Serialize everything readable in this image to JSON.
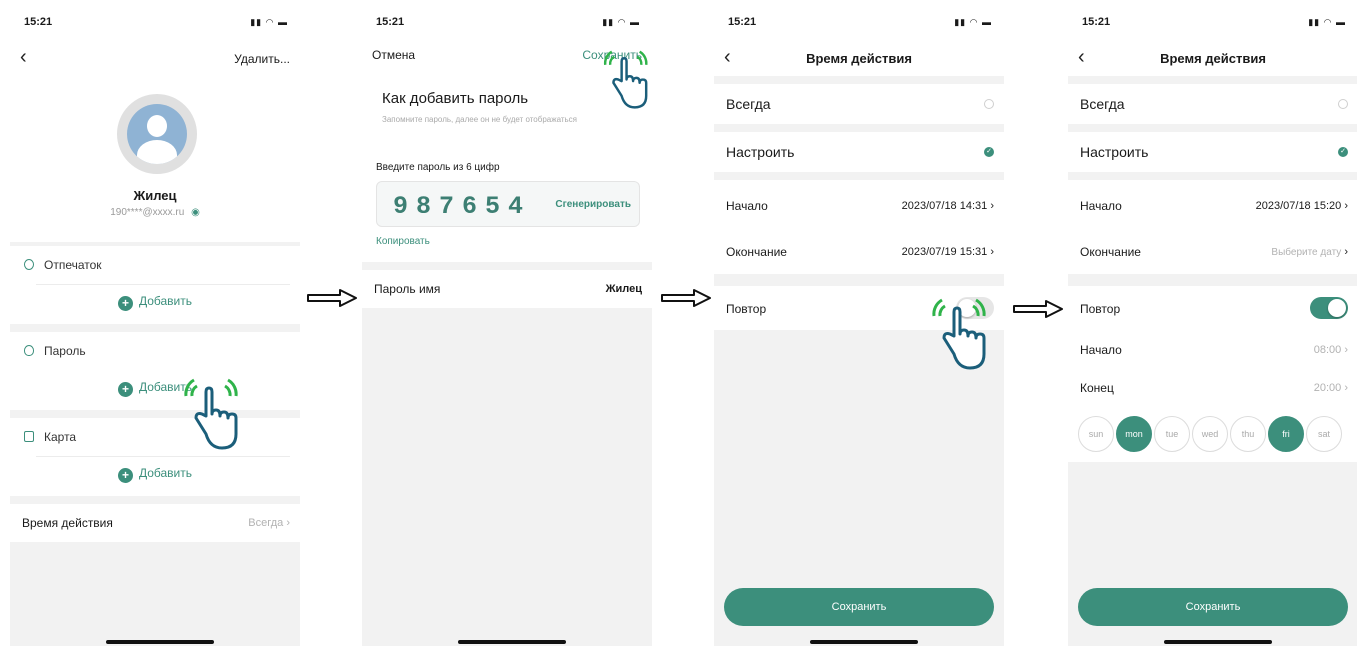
{
  "status": {
    "time": "15:21",
    "icons": "▮▮ ◠ ▬"
  },
  "screen1": {
    "right_action": "Удалить...",
    "user_name": "Жилец",
    "user_email": "190****@xxxx.ru",
    "sections": [
      {
        "label": "Отпечаток",
        "add": "Добавить"
      },
      {
        "label": "Пароль",
        "add": "Добавить"
      },
      {
        "label": "Карта",
        "add": "Добавить"
      }
    ],
    "validity_label": "Время действия",
    "validity_value": "Всегда"
  },
  "screen2": {
    "cancel": "Отмена",
    "save": "Сохранить",
    "heading": "Как добавить пароль",
    "hint": "Запомните пароль, далее он не будет отображаться",
    "pin_label": "Введите пароль из 6 цифр",
    "pin": "987654",
    "generate": "Сгенерировать",
    "copy": "Копировать",
    "name_label": "Пароль имя",
    "name_value": "Жилец"
  },
  "screen3": {
    "title": "Время действия",
    "always": "Всегда",
    "custom": "Настроить",
    "start_label": "Начало",
    "start_value": "2023/07/18 14:31",
    "end_label": "Окончание",
    "end_value": "2023/07/19 15:31",
    "repeat": "Повтор",
    "repeat_on": false,
    "save": "Сохранить"
  },
  "screen4": {
    "title": "Время действия",
    "always": "Всегда",
    "custom": "Настроить",
    "start_label": "Начало",
    "start_value": "2023/07/18 15:20",
    "end_label": "Окончание",
    "end_placeholder": "Выберите дату",
    "repeat": "Повтор",
    "repeat_on": true,
    "time_start_label": "Начало",
    "time_start_value": "08:00",
    "time_end_label": "Конец",
    "time_end_value": "20:00",
    "days": [
      {
        "label": "sun",
        "on": false
      },
      {
        "label": "mon",
        "on": true
      },
      {
        "label": "tue",
        "on": false
      },
      {
        "label": "wed",
        "on": false
      },
      {
        "label": "thu",
        "on": false
      },
      {
        "label": "fri",
        "on": true
      },
      {
        "label": "sat",
        "on": false
      }
    ],
    "save": "Сохранить"
  },
  "colors": {
    "accent": "#3c8f7c",
    "background": "#f2f2f2"
  }
}
